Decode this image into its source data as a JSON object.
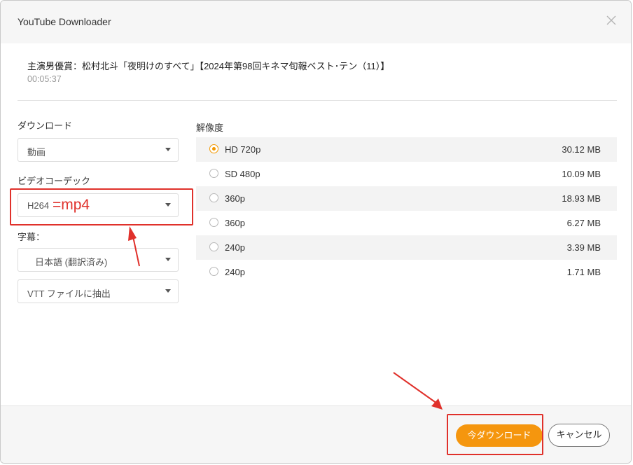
{
  "window": {
    "title": "YouTube Downloader"
  },
  "video": {
    "title": "主演男優賞：松村北斗「夜明けのすべて」【2024年第98回キネマ旬報ベスト･テン（11）】",
    "duration": "00:05:37"
  },
  "left": {
    "download_label": "ダウンロード",
    "download_value": "動画",
    "codec_label": "ビデオコーデック",
    "codec_value": "H264",
    "codec_annotation": "=mp4",
    "subtitle_label": "字幕：",
    "subtitle_language": "日本語 (翻訳済み)",
    "subtitle_format": "VTT ファイルに抽出"
  },
  "resolution": {
    "label": "解像度",
    "options": [
      {
        "name": "HD 720p",
        "size": "30.12 MB",
        "selected": true
      },
      {
        "name": "SD 480p",
        "size": "10.09 MB",
        "selected": false
      },
      {
        "name": "360p",
        "size": "18.93 MB",
        "selected": false
      },
      {
        "name": "360p",
        "size": "6.27 MB",
        "selected": false
      },
      {
        "name": "240p",
        "size": "3.39 MB",
        "selected": false
      },
      {
        "name": "240p",
        "size": "1.71 MB",
        "selected": false
      }
    ]
  },
  "footer": {
    "download_button": "今ダウンロード",
    "cancel_button": "キャンセル"
  },
  "colors": {
    "accent": "#f5960e",
    "annotation": "#e0312b"
  }
}
